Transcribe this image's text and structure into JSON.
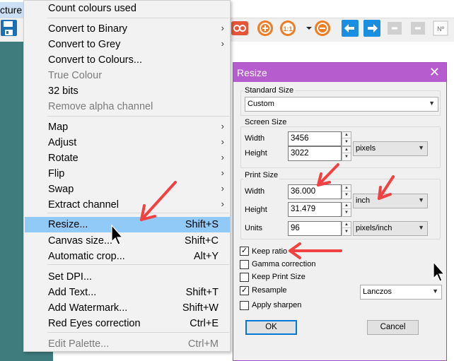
{
  "app": {
    "menu_title": "cture",
    "colors": {
      "teal_bg": "#3f7c7e",
      "title_purple": "#b65ccf",
      "highlight": "#91c9f7",
      "arrow_red": "#f24141"
    },
    "toolbar_icons": [
      "save-icon",
      "slideshow-icon",
      "zoom-in-icon",
      "actual-size-icon",
      "dropdown-icon",
      "zoom-out-icon",
      "previous-icon",
      "next-icon",
      "first-page-icon",
      "last-page-icon",
      "page-number-icon"
    ],
    "toolbar_icon_text": {
      "actual_size": "1:1",
      "page_number": "Nº"
    }
  },
  "context_menu": {
    "items": [
      {
        "label": "Count colours used",
        "shortcut": "",
        "submenu": false,
        "disabled": false
      },
      {
        "label": "Convert to Binary",
        "shortcut": "",
        "submenu": true,
        "disabled": false
      },
      {
        "label": "Convert to Grey",
        "shortcut": "",
        "submenu": true,
        "disabled": false
      },
      {
        "label": "Convert to Colours...",
        "shortcut": "",
        "submenu": false,
        "disabled": false
      },
      {
        "label": "True Colour",
        "shortcut": "",
        "submenu": false,
        "disabled": true
      },
      {
        "label": "32 bits",
        "shortcut": "",
        "submenu": false,
        "disabled": false
      },
      {
        "label": "Remove alpha channel",
        "shortcut": "",
        "submenu": false,
        "disabled": true
      },
      {
        "label": "Map",
        "shortcut": "",
        "submenu": true,
        "disabled": false
      },
      {
        "label": "Adjust",
        "shortcut": "",
        "submenu": true,
        "disabled": false
      },
      {
        "label": "Rotate",
        "shortcut": "",
        "submenu": true,
        "disabled": false
      },
      {
        "label": "Flip",
        "shortcut": "",
        "submenu": true,
        "disabled": false
      },
      {
        "label": "Swap",
        "shortcut": "",
        "submenu": true,
        "disabled": false
      },
      {
        "label": "Extract channel",
        "shortcut": "",
        "submenu": true,
        "disabled": false
      },
      {
        "label": "Resize...",
        "shortcut": "Shift+S",
        "submenu": false,
        "disabled": false,
        "selected": true
      },
      {
        "label": "Canvas size...",
        "shortcut": "Shift+C",
        "submenu": false,
        "disabled": false
      },
      {
        "label": "Automatic crop...",
        "shortcut": "Alt+Y",
        "submenu": false,
        "disabled": false
      },
      {
        "label": "Set DPI...",
        "shortcut": "",
        "submenu": false,
        "disabled": false
      },
      {
        "label": "Add Text...",
        "shortcut": "Shift+T",
        "submenu": false,
        "disabled": false
      },
      {
        "label": "Add Watermark...",
        "shortcut": "Shift+W",
        "submenu": false,
        "disabled": false
      },
      {
        "label": "Red Eyes correction",
        "shortcut": "Ctrl+E",
        "submenu": false,
        "disabled": false
      },
      {
        "label": "Edit Palette...",
        "shortcut": "Ctrl+M",
        "submenu": false,
        "disabled": true
      }
    ]
  },
  "resize_dialog": {
    "title": "Resize",
    "close_glyph": "✕",
    "standard_size": {
      "group_label": "Standard Size",
      "value": "Custom"
    },
    "screen_size": {
      "group_label": "Screen Size",
      "width_label": "Width",
      "width_value": "3456",
      "height_label": "Height",
      "height_value": "3022",
      "unit": "pixels"
    },
    "print_size": {
      "group_label": "Print Size",
      "width_label": "Width",
      "width_value": "36.000",
      "height_label": "Height",
      "height_value": "31.479",
      "unit": "inch",
      "units_label": "Units",
      "units_value": "96",
      "units_unit": "pixels/inch"
    },
    "options": {
      "keep_ratio": {
        "label": "Keep ratio",
        "checked": true
      },
      "gamma_correction": {
        "label": "Gamma correction",
        "checked": false
      },
      "keep_print_size": {
        "label": "Keep Print Size",
        "checked": false
      },
      "resample": {
        "label": "Resample",
        "checked": true,
        "method": "Lanczos"
      },
      "apply_sharpen": {
        "label": "Apply sharpen",
        "checked": false
      }
    },
    "ok_label": "OK",
    "cancel_label": "Cancel"
  }
}
